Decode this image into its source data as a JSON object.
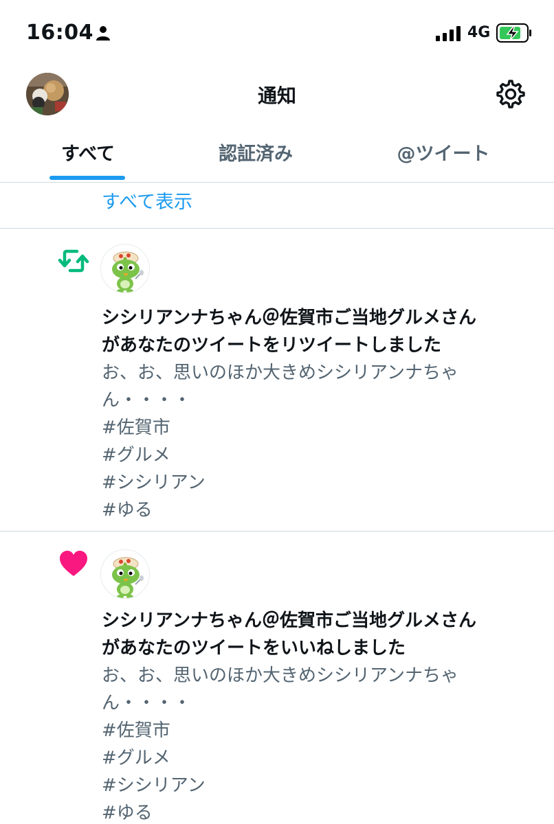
{
  "status_bar": {
    "time": "16:04",
    "network": "4G",
    "icons": [
      "person-icon",
      "signal-icon",
      "battery-charging-icon"
    ]
  },
  "header": {
    "title": "通知",
    "icons": [
      "avatar",
      "settings-gear-icon"
    ]
  },
  "tabs": [
    {
      "label": "すべて",
      "active": true
    },
    {
      "label": "認証済み",
      "active": false
    },
    {
      "label": "@ツイート",
      "active": false
    }
  ],
  "show_all_label": "すべて表示",
  "colors": {
    "accent": "#1d9bf0",
    "retweet": "#00ba7c",
    "like": "#f91880",
    "secondary_text": "#536471"
  },
  "notifications": [
    {
      "type": "retweet",
      "icon": "retweet-icon",
      "headline_line1": "シシリアンナちゃん＠佐賀市ご当地グルメさん",
      "headline_line2": "があなたのツイートをリツイートしました",
      "text_lines": [
        "お、お、思いのほか大きめシシリアンナちゃ",
        "ん・・・・",
        "#佐賀市",
        "#グルメ",
        "#シシリアン",
        "#ゆる"
      ]
    },
    {
      "type": "like",
      "icon": "heart-icon",
      "headline_line1": "シシリアンナちゃん＠佐賀市ご当地グルメさん",
      "headline_line2": "があなたのツイートをいいねしました",
      "text_lines": [
        "お、お、思いのほか大きめシシリアンナちゃ",
        "ん・・・・",
        "#佐賀市",
        "#グルメ",
        "#シシリアン",
        "#ゆる"
      ]
    }
  ]
}
